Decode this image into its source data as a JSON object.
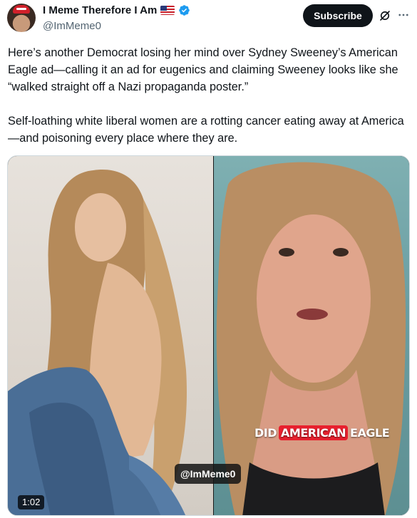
{
  "header": {
    "display_name": "I Meme Therefore I Am",
    "handle": "@ImMeme0",
    "subscribe_label": "Subscribe",
    "flag_icon": "us-flag-icon",
    "verified_icon": "verified-badge-icon",
    "grok_icon": "grok-icon",
    "more_icon": "more-options-icon",
    "colors": {
      "verified": "#1d9bf0",
      "button_bg": "#0f1419",
      "button_text": "#ffffff"
    }
  },
  "tweet": {
    "paragraphs": [
      "Here’s another Democrat losing her mind over Sydney Sweeney’s American Eagle ad—calling it an ad for eugenics and claiming Sweeney looks like she “walked straight off a Nazi propaganda poster.”",
      "Self-loathing white liberal women are a rotting cancer eating away at America—and poisoning every place where they are."
    ]
  },
  "media": {
    "caption_before": "DID",
    "caption_highlight": "AMERICAN",
    "caption_after": "EAGLE",
    "watermark": "@ImMeme0",
    "duration": "1:02",
    "highlight_color": "#e8202e"
  }
}
